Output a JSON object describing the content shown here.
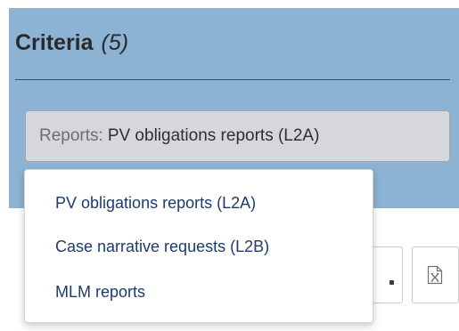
{
  "criteria": {
    "title": "Criteria",
    "count": "(5)"
  },
  "filter": {
    "key_label": "Reports:",
    "selected_value": "PV obligations reports (L2A)"
  },
  "dropdown": {
    "options": [
      {
        "label": "PV obligations reports (L2A)"
      },
      {
        "label": "Case narrative requests (L2B)"
      },
      {
        "label": "MLM reports"
      }
    ]
  },
  "colors": {
    "criteria_panel_bg": "#8cb3d3",
    "filter_chip_bg": "#d5d7da",
    "menu_item_text": "#1e3b6e"
  },
  "icons": {
    "excel_export": "excel-export-icon",
    "more": "more-dot-icon"
  }
}
